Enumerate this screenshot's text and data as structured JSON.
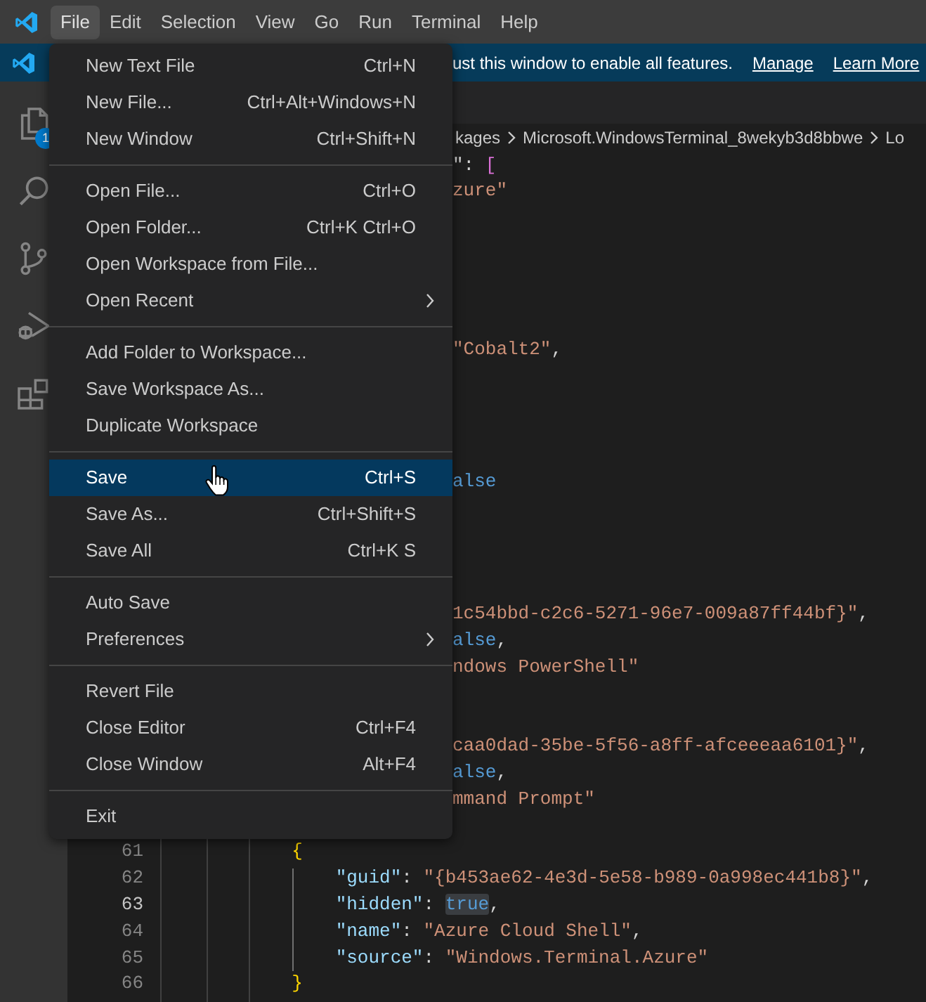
{
  "menu_bar": [
    {
      "label": "File",
      "selected": true
    },
    {
      "label": "Edit",
      "selected": false
    },
    {
      "label": "Selection",
      "selected": false
    },
    {
      "label": "View",
      "selected": false
    },
    {
      "label": "Go",
      "selected": false
    },
    {
      "label": "Run",
      "selected": false
    },
    {
      "label": "Terminal",
      "selected": false
    },
    {
      "label": "Help",
      "selected": false
    }
  ],
  "banner": {
    "message": "ust this window to enable all features.",
    "links": [
      "Manage",
      "Learn More"
    ]
  },
  "activity_bar": [
    {
      "kind": "files",
      "badge": "1"
    },
    {
      "kind": "search"
    },
    {
      "kind": "source-control"
    },
    {
      "kind": "run-debug"
    },
    {
      "kind": "extensions"
    }
  ],
  "breadcrumb": [
    "kages",
    "Microsoft.WindowsTerminal_8wekyb3d8bbwe",
    "Lo"
  ],
  "file_menu": {
    "groups": [
      [
        {
          "label": "New Text File",
          "shortcut": "Ctrl+N",
          "selected": false,
          "submenu": false
        },
        {
          "label": "New File...",
          "shortcut": "Ctrl+Alt+Windows+N",
          "selected": false,
          "submenu": false
        },
        {
          "label": "New Window",
          "shortcut": "Ctrl+Shift+N",
          "selected": false,
          "submenu": false
        }
      ],
      [
        {
          "label": "Open File...",
          "shortcut": "Ctrl+O",
          "selected": false,
          "submenu": false
        },
        {
          "label": "Open Folder...",
          "shortcut": "Ctrl+K Ctrl+O",
          "selected": false,
          "submenu": false
        },
        {
          "label": "Open Workspace from File...",
          "selected": false,
          "submenu": false
        },
        {
          "label": "Open Recent",
          "selected": false,
          "submenu": true
        }
      ],
      [
        {
          "label": "Add Folder to Workspace...",
          "selected": false,
          "submenu": false
        },
        {
          "label": "Save Workspace As...",
          "selected": false,
          "submenu": false
        },
        {
          "label": "Duplicate Workspace",
          "selected": false,
          "submenu": false
        }
      ],
      [
        {
          "label": "Save",
          "shortcut": "Ctrl+S",
          "selected": true,
          "submenu": false
        },
        {
          "label": "Save As...",
          "shortcut": "Ctrl+Shift+S",
          "selected": false,
          "submenu": false
        },
        {
          "label": "Save All",
          "shortcut": "Ctrl+K S",
          "selected": false,
          "submenu": false
        }
      ],
      [
        {
          "label": "Auto Save",
          "selected": false,
          "submenu": false
        },
        {
          "label": "Preferences",
          "selected": false,
          "submenu": true
        }
      ],
      [
        {
          "label": "Revert File",
          "selected": false,
          "submenu": false
        },
        {
          "label": "Close Editor",
          "shortcut": "Ctrl+F4",
          "selected": false,
          "submenu": false
        },
        {
          "label": "Close Window",
          "shortcut": "Alt+F4",
          "selected": false,
          "submenu": false
        }
      ],
      [
        {
          "label": "Exit",
          "selected": false,
          "submenu": false
        }
      ]
    ]
  },
  "editor": {
    "lines": [
      {
        "tokens": [
          {
            "kind": "punct",
            "text": "\": "
          },
          {
            "kind": "bracket-pink",
            "text": "["
          }
        ]
      },
      {
        "tokens": [
          {
            "kind": "string",
            "text": "zure\""
          }
        ]
      },
      {
        "tokens": [
          {
            "kind": "string",
            "text": "\"Cobalt2\""
          },
          {
            "kind": "punct",
            "text": ","
          }
        ]
      },
      {
        "tokens": [
          {
            "kind": "bool",
            "text": "alse"
          }
        ]
      },
      {
        "tokens": [
          {
            "kind": "string",
            "text": "1c54bbd-c2c6-5271-96e7-009a87ff44bf}\""
          },
          {
            "kind": "punct",
            "text": ","
          }
        ]
      },
      {
        "tokens": [
          {
            "kind": "bool",
            "text": "alse"
          },
          {
            "kind": "punct",
            "text": ","
          }
        ]
      },
      {
        "tokens": [
          {
            "kind": "string",
            "text": "ndows PowerShell\""
          }
        ]
      },
      {
        "tokens": [
          {
            "kind": "string",
            "text": "caa0dad-35be-5f56-a8ff-afceeeaa6101}\""
          },
          {
            "kind": "punct",
            "text": ","
          }
        ]
      },
      {
        "tokens": [
          {
            "kind": "bool",
            "text": "alse"
          },
          {
            "kind": "punct",
            "text": ","
          }
        ]
      },
      {
        "tokens": [
          {
            "kind": "string",
            "text": "mmand Prompt\""
          }
        ]
      },
      {
        "number": "61",
        "current": false,
        "tokens": [
          {
            "kind": "bracket-gold",
            "text": "            {"
          }
        ]
      },
      {
        "number": "62",
        "current": false,
        "tokens": [
          {
            "kind": "key",
            "text": "                \"guid\""
          },
          {
            "kind": "punct",
            "text": ": "
          },
          {
            "kind": "string",
            "text": "\"{b453ae62-4e3d-5e58-b989-0a998ec441b8}\""
          },
          {
            "kind": "punct",
            "text": ","
          }
        ]
      },
      {
        "number": "63",
        "current": true,
        "tokens": [
          {
            "kind": "key",
            "text": "                \"hidden\""
          },
          {
            "kind": "punct",
            "text": ": "
          },
          {
            "kind": "bool",
            "text": "true",
            "highlight": true
          },
          {
            "kind": "punct",
            "text": ","
          }
        ]
      },
      {
        "number": "64",
        "current": false,
        "tokens": [
          {
            "kind": "key",
            "text": "                \"name\""
          },
          {
            "kind": "punct",
            "text": ": "
          },
          {
            "kind": "string",
            "text": "\"Azure Cloud Shell\""
          },
          {
            "kind": "punct",
            "text": ","
          }
        ]
      },
      {
        "number": "65",
        "current": false,
        "tokens": [
          {
            "kind": "key",
            "text": "                \"source\""
          },
          {
            "kind": "punct",
            "text": ": "
          },
          {
            "kind": "string",
            "text": "\"Windows.Terminal.Azure\""
          }
        ]
      },
      {
        "number": "66",
        "current": false,
        "tokens": [
          {
            "kind": "bracket-gold",
            "text": "            }"
          }
        ]
      }
    ]
  }
}
